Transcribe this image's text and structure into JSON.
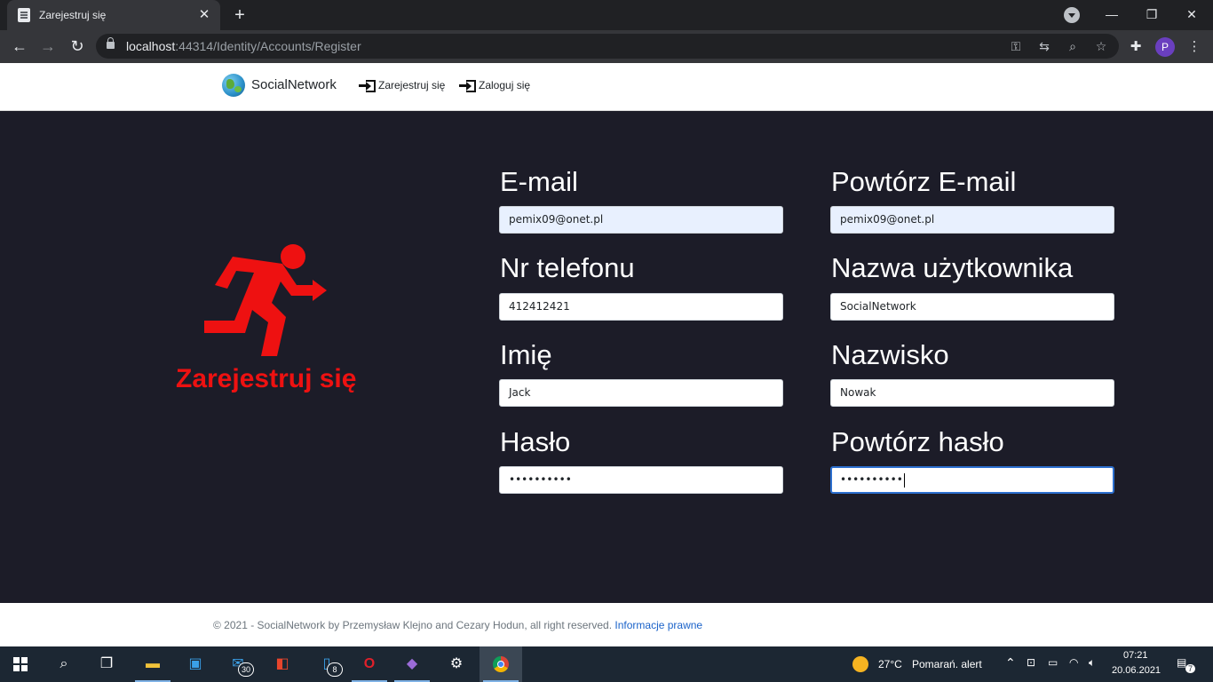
{
  "browser": {
    "tab_title": "Zarejestruj się",
    "tab_close": "✕",
    "new_tab": "+",
    "url_host": "localhost",
    "url_rest": ":44314/Identity/Accounts/Register",
    "profile_initial": "P",
    "window_controls": {
      "minimize": "—",
      "restore": "❐",
      "close": "✕"
    }
  },
  "header": {
    "brand": "SocialNetwork",
    "nav": {
      "register": "Zarejestruj się",
      "login": "Zaloguj się"
    }
  },
  "hero": {
    "title": "Zarejestruj się"
  },
  "form": {
    "email": {
      "label": "E-mail",
      "value": "pemix09@onet.pl"
    },
    "email_confirm": {
      "label": "Powtórz E-mail",
      "value": "pemix09@onet.pl"
    },
    "phone": {
      "label": "Nr telefonu",
      "value": "412412421"
    },
    "username": {
      "label": "Nazwa użytkownika",
      "value": "SocialNetwork"
    },
    "first_name": {
      "label": "Imię",
      "value": "Jack"
    },
    "last_name": {
      "label": "Nazwisko",
      "value": "Nowak"
    },
    "password": {
      "label": "Hasło",
      "value": "••••••••••"
    },
    "password_confirm": {
      "label": "Powtórz hasło",
      "value": "••••••••••"
    }
  },
  "footer": {
    "text": "© 2021 - SocialNetwork by Przemysław Klejno and Cezary Hodun, all right reserved.",
    "link": "Informacje prawne"
  },
  "taskbar": {
    "mail_badge": "30",
    "phone_badge": "8",
    "weather_temp": "27°C",
    "weather_alert": "Pomarań. alert",
    "time": "07:21",
    "date": "20.06.2021",
    "notifications": "7"
  },
  "colors": {
    "accent_red": "#ee1111",
    "page_bg": "#1c1c28",
    "link_blue": "#1a62c9",
    "autofill_bg": "#e8f0fe"
  },
  "icons": {
    "hero": "running-man-exit-icon",
    "nav": "enter-arrow-icon",
    "brand": "globe-icon"
  }
}
